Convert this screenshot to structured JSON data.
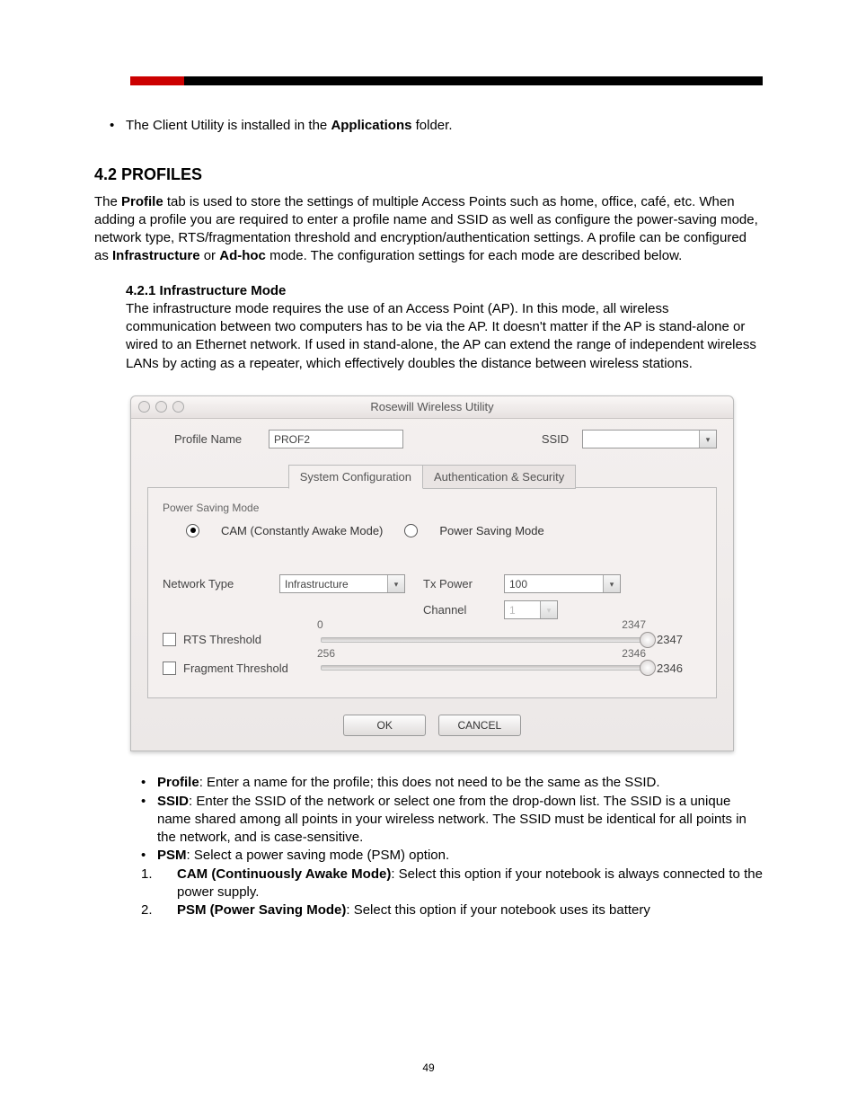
{
  "doc": {
    "page_number": "49",
    "intro_bullet_prefix": "The Client Utility is installed in the ",
    "intro_bullet_bold": "Applications",
    "intro_bullet_suffix": " folder.",
    "section_heading": "4.2 PROFILES",
    "profiles_para_1a": "The ",
    "profiles_para_1b_bold": "Profile",
    "profiles_para_1c": " tab is used to store the settings of multiple Access Points such as home, office, café, etc. When adding a profile you are required to enter a profile name and SSID as well as configure the power-saving mode, network type, RTS/fragmentation threshold and encryption/authentication settings.  A profile can be configured as ",
    "profiles_para_1d_bold": "Infrastructure",
    "profiles_para_1e": " or ",
    "profiles_para_1f_bold": "Ad-hoc",
    "profiles_para_1g": " mode. The configuration settings for each mode are described below.",
    "sub_heading": "4.2.1 Infrastructure Mode",
    "sub_para": "The infrastructure mode requires the use of an Access Point (AP). In this mode, all wireless communication between two computers has to be via the AP. It doesn't matter if the AP is stand-alone or wired to an Ethernet network. If used in stand-alone, the AP can extend the range of independent wireless LANs by acting as a repeater, which effectively doubles the distance between wireless stations.",
    "bullets": {
      "profile": {
        "term": "Profile",
        "desc": ": Enter a name for the profile; this does not need to be the same as the SSID."
      },
      "ssid": {
        "term": "SSID",
        "desc": ": Enter the SSID of the network or select one from the drop-down list. The SSID is a unique name shared among all points in your wireless network. The SSID must be identical for all points in the network, and is case-sensitive."
      },
      "psm": {
        "term": "PSM",
        "desc": ": Select a power saving mode (PSM) option."
      }
    },
    "numlist": {
      "cam": {
        "n": "1.",
        "term": "CAM (Continuously Awake Mode)",
        "desc": ": Select this option if your notebook is always connected to the power supply."
      },
      "psm": {
        "n": "2.",
        "term": "PSM (Power Saving Mode)",
        "desc": ": Select this option if your notebook uses its battery"
      }
    }
  },
  "ui": {
    "window_title": "Rosewill Wireless Utility",
    "profile_name_label": "Profile Name",
    "profile_name_value": "PROF2",
    "ssid_label": "SSID",
    "ssid_value": "",
    "tabs": {
      "sysconf": "System Configuration",
      "auth": "Authentication & Security"
    },
    "psm_group_label": "Power Saving Mode",
    "radio_cam_label": "CAM (Constantly Awake Mode)",
    "radio_psm_label": "Power Saving Mode",
    "network_type_label": "Network Type",
    "network_type_value": "Infrastructure",
    "tx_power_label": "Tx Power",
    "tx_power_value": "100",
    "channel_label": "Channel",
    "channel_value": "1",
    "rts_label": "RTS Threshold",
    "rts_min": "0",
    "rts_max": "2347",
    "rts_value": "2347",
    "frag_label": "Fragment Threshold",
    "frag_min": "256",
    "frag_max": "2346",
    "frag_value": "2346",
    "ok_label": "OK",
    "cancel_label": "CANCEL"
  }
}
